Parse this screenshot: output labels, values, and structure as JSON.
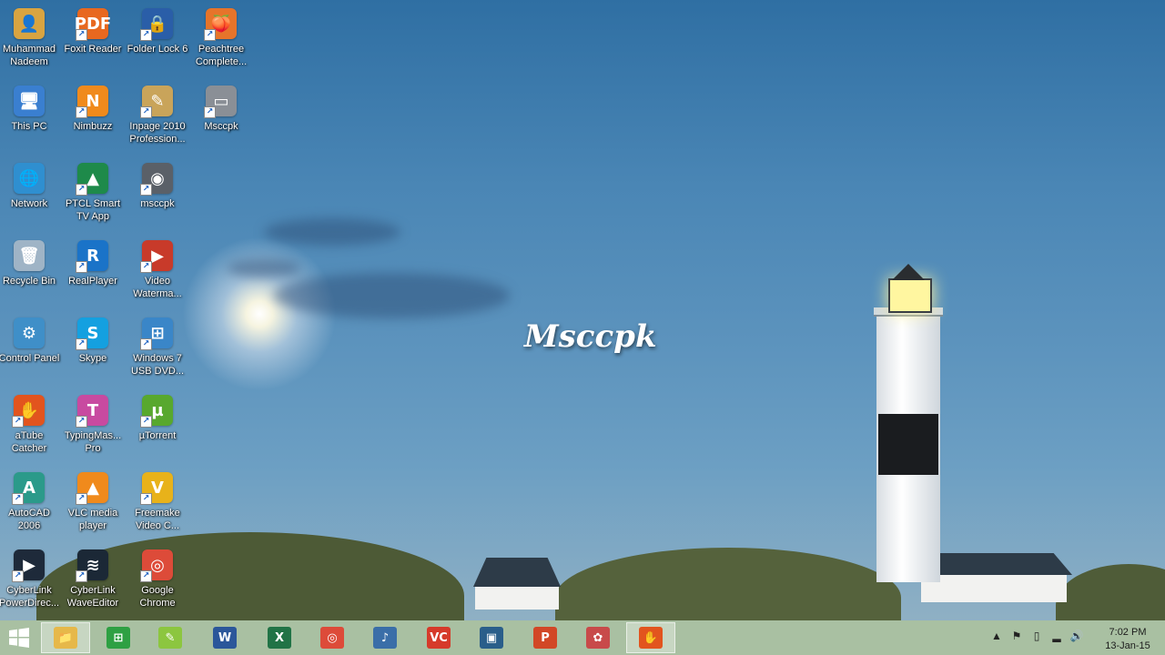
{
  "wallpaper": {
    "watermark": "Msccpk"
  },
  "desktop_icons": [
    {
      "label": "Muhammad Nadeem",
      "icon": "user-folder-icon",
      "color": "#d9a441",
      "glyph": "👤"
    },
    {
      "label": "Foxit Reader",
      "icon": "foxit-reader-icon",
      "color": "#e8681f",
      "glyph": "PDF"
    },
    {
      "label": "Folder Lock 6",
      "icon": "folder-lock-icon",
      "color": "#2a5ea8",
      "glyph": "🔒"
    },
    {
      "label": "Peachtree Complete...",
      "icon": "peachtree-icon",
      "color": "#e6742a",
      "glyph": "🍑"
    },
    {
      "label": "This PC",
      "icon": "computer-icon",
      "color": "#3a7fd0",
      "glyph": "🖥"
    },
    {
      "label": "Nimbuzz",
      "icon": "nimbuzz-icon",
      "color": "#f08a1c",
      "glyph": "N"
    },
    {
      "label": "Inpage 2010 Profession...",
      "icon": "inpage-icon",
      "color": "#c9a45a",
      "glyph": "✎"
    },
    {
      "label": "Msccpk",
      "icon": "msccpk-shortcut-icon",
      "color": "#8a8f96",
      "glyph": "▭"
    },
    {
      "label": "Network",
      "icon": "network-icon",
      "color": "#2f8fd0",
      "glyph": "🌐"
    },
    {
      "label": "PTCL Smart TV App",
      "icon": "ptcl-tv-icon",
      "color": "#1e8a4a",
      "glyph": "▲"
    },
    {
      "label": "msccpk",
      "icon": "webcam-icon",
      "color": "#5a6068",
      "glyph": "◉"
    },
    {
      "label": "Recycle Bin",
      "icon": "recycle-bin-icon",
      "color": "#9fb4c6",
      "glyph": "🗑"
    },
    {
      "label": "RealPlayer",
      "icon": "realplayer-icon",
      "color": "#1a73c8",
      "glyph": "R"
    },
    {
      "label": "Video Waterma...",
      "icon": "video-watermark-icon",
      "color": "#c83a2a",
      "glyph": "▶"
    },
    {
      "label": "Control Panel",
      "icon": "control-panel-icon",
      "color": "#3f8fc8",
      "glyph": "⚙"
    },
    {
      "label": "Skype",
      "icon": "skype-icon",
      "color": "#14a0e0",
      "glyph": "S"
    },
    {
      "label": "Windows 7 USB DVD...",
      "icon": "windows-usb-dvd-icon",
      "color": "#3a86c8",
      "glyph": "⊞"
    },
    {
      "label": "aTube Catcher",
      "icon": "atube-catcher-icon",
      "color": "#e2541e",
      "glyph": "✋"
    },
    {
      "label": "TypingMas... Pro",
      "icon": "typingmaster-icon",
      "color": "#c84aa0",
      "glyph": "T"
    },
    {
      "label": "µTorrent",
      "icon": "utorrent-icon",
      "color": "#58a82e",
      "glyph": "µ"
    },
    {
      "label": "AutoCAD 2006",
      "icon": "autocad-icon",
      "color": "#2b9a8a",
      "glyph": "A"
    },
    {
      "label": "VLC media player",
      "icon": "vlc-icon",
      "color": "#f08a1c",
      "glyph": "▲"
    },
    {
      "label": "Freemake Video C...",
      "icon": "freemake-icon",
      "color": "#e8b21a",
      "glyph": "V"
    },
    {
      "label": "CyberLink PowerDirec...",
      "icon": "powerdirector-icon",
      "color": "#1e2a3a",
      "glyph": "▶"
    },
    {
      "label": "CyberLink WaveEditor",
      "icon": "waveeditor-icon",
      "color": "#1b2836",
      "glyph": "≋"
    },
    {
      "label": "Google Chrome",
      "icon": "chrome-icon",
      "color": "#dd4b39",
      "glyph": "◎"
    }
  ],
  "taskbar": {
    "apps": [
      {
        "name": "file-explorer",
        "icon": "file-explorer-icon",
        "color": "#e6b84a",
        "glyph": "📁",
        "active": true
      },
      {
        "name": "store",
        "icon": "store-icon",
        "color": "#2ea043",
        "glyph": "⊞",
        "active": false
      },
      {
        "name": "notepad-plus",
        "icon": "notepad-icon",
        "color": "#8cc63f",
        "glyph": "✎",
        "active": false
      },
      {
        "name": "word",
        "icon": "word-icon",
        "color": "#2b579a",
        "glyph": "W",
        "active": false
      },
      {
        "name": "excel",
        "icon": "excel-icon",
        "color": "#217346",
        "glyph": "X",
        "active": false
      },
      {
        "name": "chrome",
        "icon": "chrome-icon",
        "color": "#dd4b39",
        "glyph": "◎",
        "active": false
      },
      {
        "name": "media-app",
        "icon": "media-app-icon",
        "color": "#3a6ea8",
        "glyph": "♪",
        "active": false
      },
      {
        "name": "vc-app",
        "icon": "vc-icon",
        "color": "#d63a2a",
        "glyph": "VC",
        "active": false
      },
      {
        "name": "screen-recorder",
        "icon": "monitor-icon",
        "color": "#2a5e8a",
        "glyph": "▣",
        "active": false
      },
      {
        "name": "powerpoint",
        "icon": "powerpoint-icon",
        "color": "#d24726",
        "glyph": "P",
        "active": false
      },
      {
        "name": "paint-app",
        "icon": "paint-icon",
        "color": "#c84a4a",
        "glyph": "✿",
        "active": false
      },
      {
        "name": "atube-catcher",
        "icon": "atube-catcher-icon",
        "color": "#e2541e",
        "glyph": "✋",
        "active": true
      }
    ],
    "tray": {
      "icons": [
        "show-hidden-icons-icon",
        "flag-icon",
        "power-icon",
        "signal-icon",
        "volume-icon"
      ],
      "glyphs": [
        "▲",
        "⚑",
        "▯",
        "▂",
        "🔊"
      ],
      "time": "7:02 PM",
      "date": "13-Jan-15"
    }
  }
}
